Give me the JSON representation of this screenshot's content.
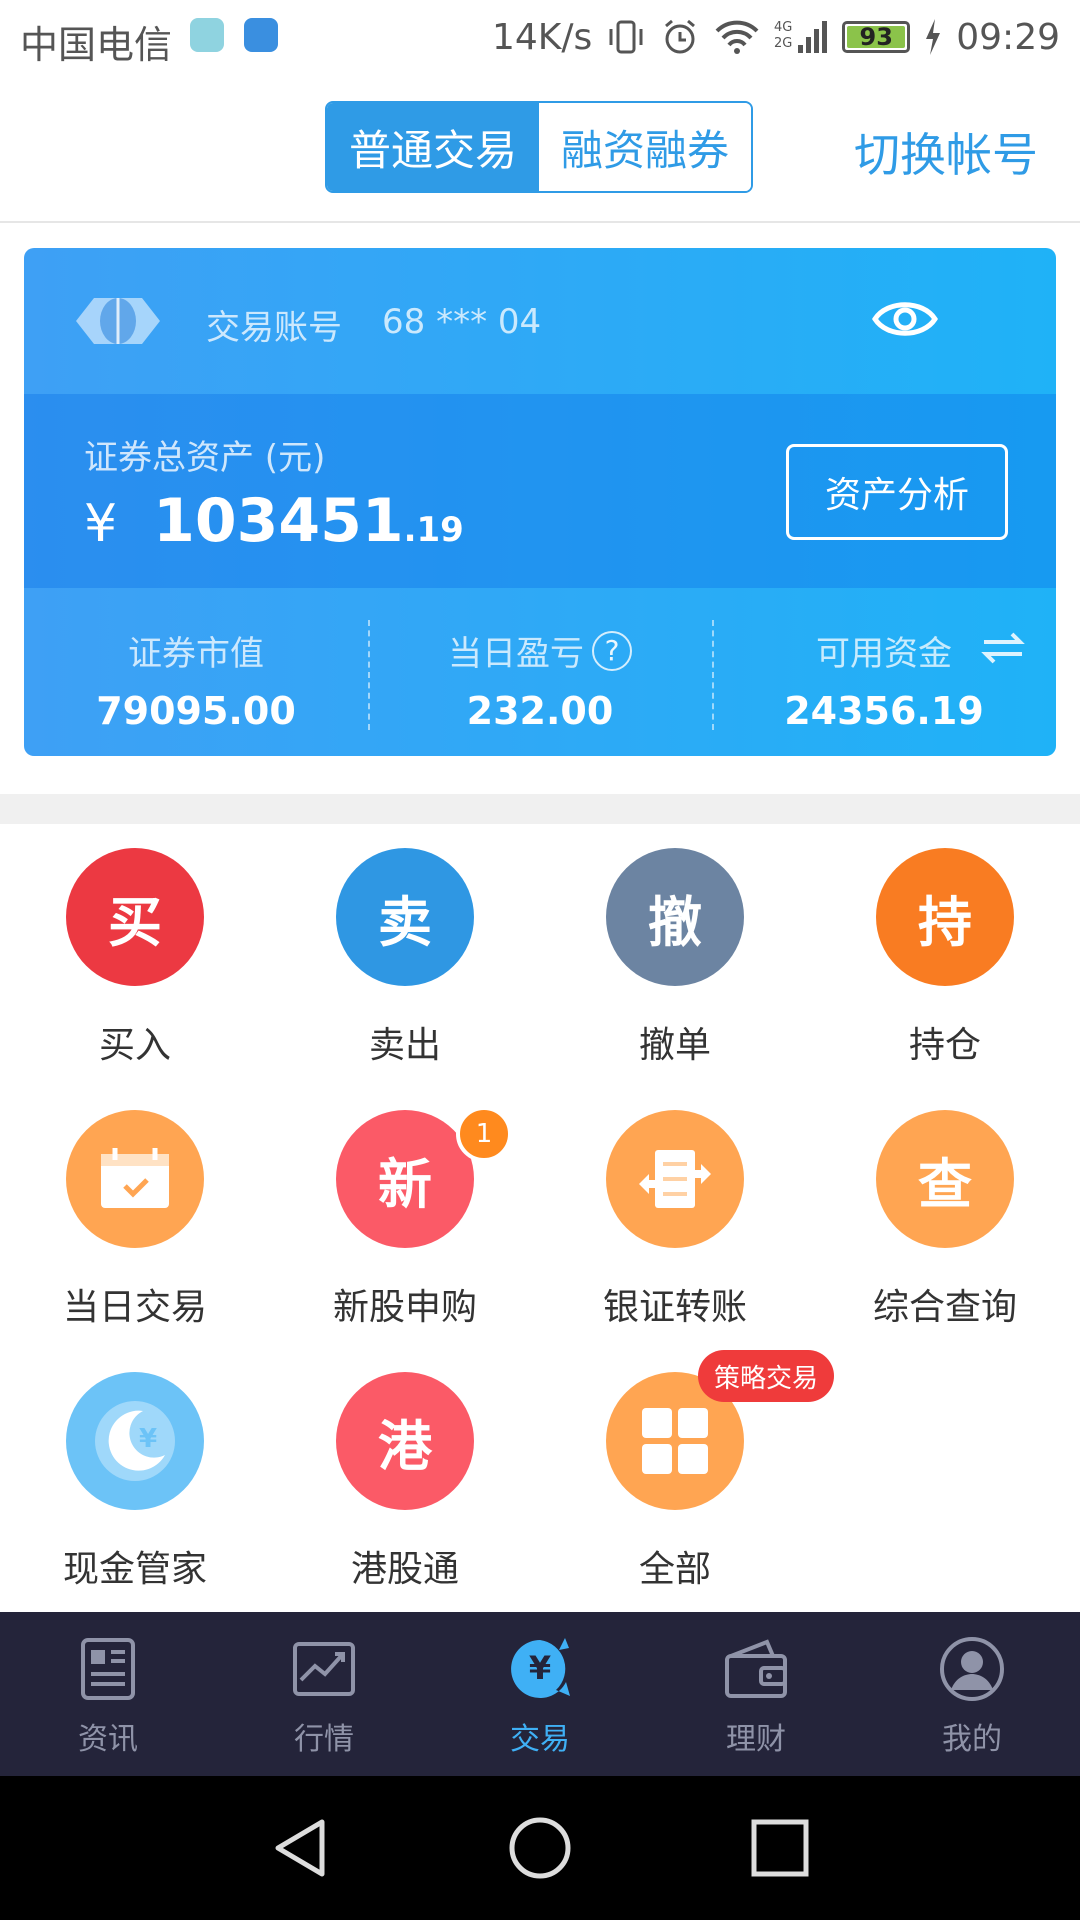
{
  "status_bar": {
    "carrier": "中国电信",
    "network_speed": "14K/s",
    "network_type": "4G 2G",
    "battery": "93",
    "time": "09:29"
  },
  "header": {
    "tabs": [
      "普通交易",
      "融资融券"
    ],
    "active_tab": 0,
    "switch_account": "切换帐号"
  },
  "account_card": {
    "account_label": "交易账号",
    "account_number": "68 *** 04",
    "total_assets_label": "证券总资产 (元)",
    "currency_symbol": "¥",
    "total_assets_integer": "103451",
    "total_assets_decimal": ".19",
    "analysis_button": "资产分析",
    "stats": [
      {
        "label": "证券市值",
        "value": "79095.00"
      },
      {
        "label": "当日盈亏",
        "value": "232.00"
      },
      {
        "label": "可用资金",
        "value": "24356.19"
      }
    ]
  },
  "functions": [
    {
      "glyph": "买",
      "label": "买入",
      "color": "#ec3942"
    },
    {
      "glyph": "卖",
      "label": "卖出",
      "color": "#2f97e3"
    },
    {
      "glyph": "撤",
      "label": "撤单",
      "color": "#6c84a2"
    },
    {
      "glyph": "持",
      "label": "持仓",
      "color": "#f97c22"
    },
    {
      "glyph": "calendar-icon",
      "label": "当日交易",
      "color": "#ffa552"
    },
    {
      "glyph": "新",
      "label": "新股申购",
      "color": "#fb5a67",
      "badge": "1"
    },
    {
      "glyph": "transfer-icon",
      "label": "银证转账",
      "color": "#ffa552"
    },
    {
      "glyph": "查",
      "label": "综合查询",
      "color": "#ffa552"
    },
    {
      "glyph": "moon-yen-icon",
      "label": "现金管家",
      "color": "#6cc3f7"
    },
    {
      "glyph": "港",
      "label": "港股通",
      "color": "#fb5a67"
    },
    {
      "glyph": "grid-icon",
      "label": "全部",
      "color": "#ffa552",
      "tag": "策略交易"
    }
  ],
  "tab_bar": {
    "items": [
      "资讯",
      "行情",
      "交易",
      "理财",
      "我的"
    ],
    "active": 2,
    "trade_symbol": "¥"
  }
}
